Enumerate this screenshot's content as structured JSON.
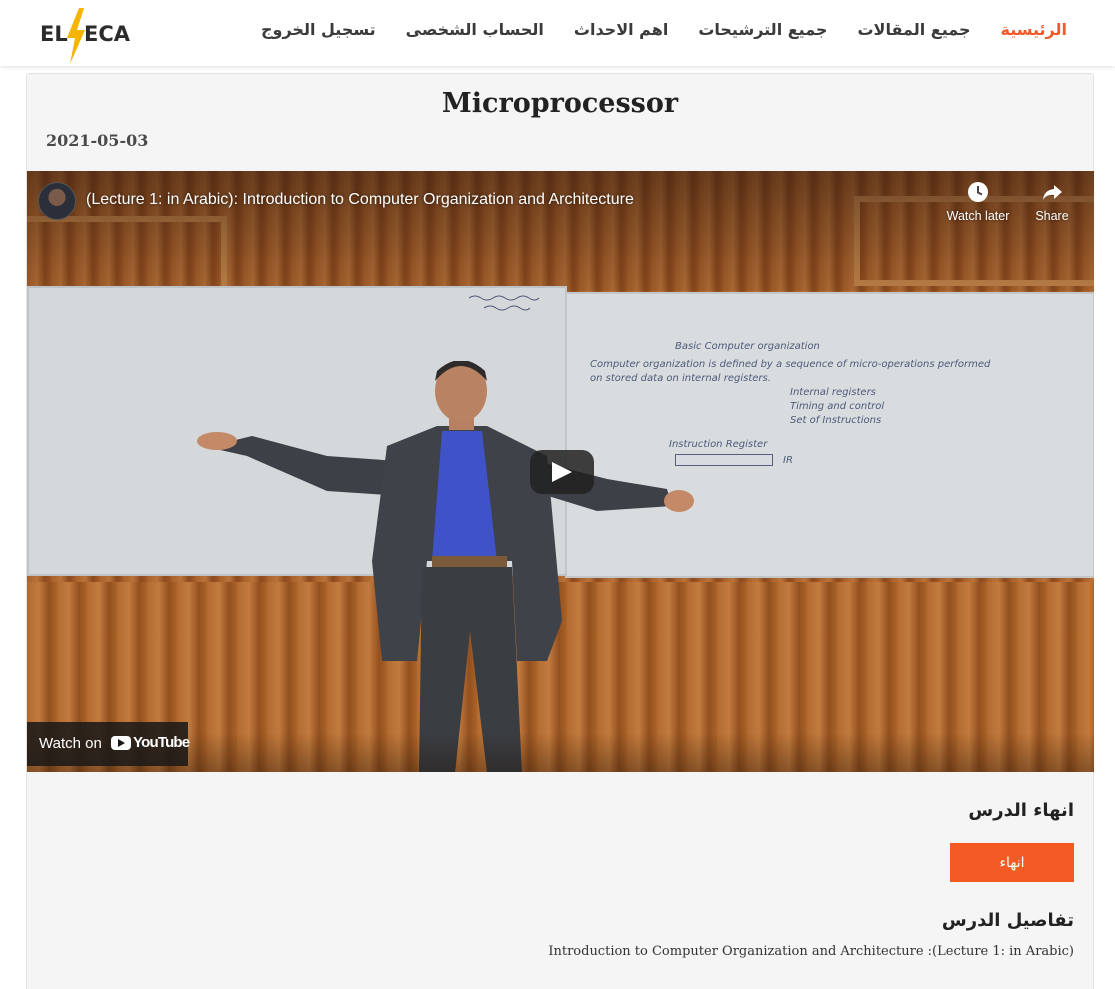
{
  "brand": {
    "logo_text_left": "EL",
    "logo_text_right": "ECA",
    "accent": "#f05a28",
    "bolt_color": "#f4b400"
  },
  "nav": {
    "items": [
      {
        "label": "الرئيسية",
        "active": true
      },
      {
        "label": "جميع المقالات",
        "active": false
      },
      {
        "label": "جميع الترشيحات",
        "active": false
      },
      {
        "label": "اهم الاحداث",
        "active": false
      },
      {
        "label": "الحساب الشخصى",
        "active": false
      },
      {
        "label": "تسجيل الخروج",
        "active": false
      }
    ]
  },
  "lesson": {
    "title": "Microprocessor",
    "date": "2021-05-03"
  },
  "video": {
    "title": "(Lecture 1: in Arabic): Introduction to Computer Organization and Architecture",
    "watch_later_label": "Watch later",
    "share_label": "Share",
    "watch_on_label": "Watch on",
    "youtube_label": "YouTube",
    "board_text": {
      "heading": "Basic Computer organization",
      "line1": "Computer organization is defined by a sequence of micro-operations performed",
      "line2": "on stored data on internal registers.",
      "item1": "Internal registers",
      "item2": "Timing and control",
      "item3": "Set of Instructions",
      "reg_label": "Instruction Register",
      "ir": "IR"
    }
  },
  "finish": {
    "heading": "انهاء الدرس",
    "button_label": "انهاء",
    "button_color": "#f45a24"
  },
  "details": {
    "heading": "تفاصيل الدرس",
    "text": "Introduction to Computer Organization and Architecture :(Lecture 1: in Arabic)"
  }
}
